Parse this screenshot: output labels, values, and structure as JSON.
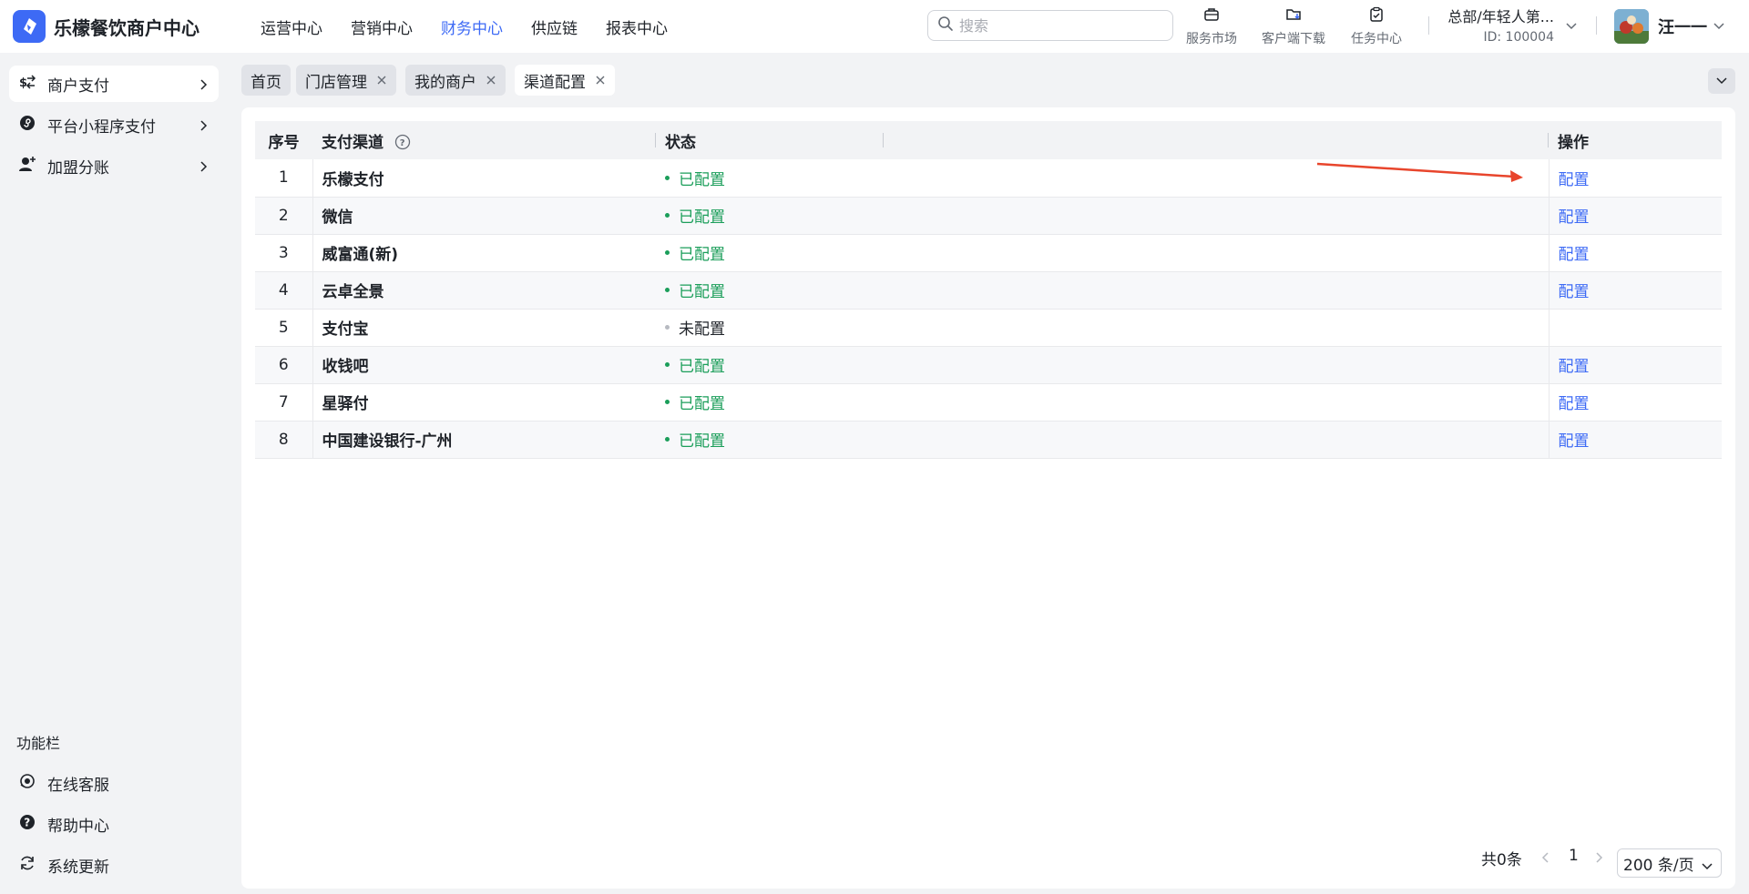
{
  "brand": {
    "name": "乐檬餐饮商户中心"
  },
  "topnav": [
    {
      "label": "运营中心",
      "active": false
    },
    {
      "label": "营销中心",
      "active": false
    },
    {
      "label": "财务中心",
      "active": true
    },
    {
      "label": "供应链",
      "active": false
    },
    {
      "label": "报表中心",
      "active": false
    }
  ],
  "search": {
    "placeholder": "搜索",
    "value": ""
  },
  "tools": [
    {
      "label": "服务市场",
      "icon": "briefcase-icon"
    },
    {
      "label": "客户端下载",
      "icon": "folder-download-icon"
    },
    {
      "label": "任务中心",
      "icon": "clipboard-check-icon"
    }
  ],
  "org": {
    "name": "总部/年轻人第...",
    "id": "ID: 100004"
  },
  "user": {
    "name": "汪一一"
  },
  "sidebar": {
    "items": [
      {
        "label": "商户支付",
        "icon": "dollar-exchange-icon",
        "active": true
      },
      {
        "label": "平台小程序支付",
        "icon": "mini-program-icon",
        "active": false
      },
      {
        "label": "加盟分账",
        "icon": "user-add-icon",
        "active": false
      }
    ],
    "section_title": "功能栏",
    "footer_items": [
      {
        "label": "在线客服",
        "icon": "headset-icon"
      },
      {
        "label": "帮助中心",
        "icon": "help-icon"
      },
      {
        "label": "系统更新",
        "icon": "refresh-icon"
      }
    ]
  },
  "tabs": [
    {
      "label": "首页",
      "closable": false,
      "active": false
    },
    {
      "label": "门店管理",
      "closable": true,
      "active": false
    },
    {
      "label": "我的商户",
      "closable": true,
      "active": false
    },
    {
      "label": "渠道配置",
      "closable": true,
      "active": true
    }
  ],
  "table": {
    "columns": {
      "seq": "序号",
      "channel": "支付渠道",
      "status": "状态",
      "action": "操作"
    },
    "rows": [
      {
        "seq": "1",
        "channel": "乐檬支付",
        "status": "已配置",
        "configured": true,
        "action": "配置"
      },
      {
        "seq": "2",
        "channel": "微信",
        "status": "已配置",
        "configured": true,
        "action": "配置"
      },
      {
        "seq": "3",
        "channel": "威富通(新)",
        "status": "已配置",
        "configured": true,
        "action": "配置"
      },
      {
        "seq": "4",
        "channel": "云卓全景",
        "status": "已配置",
        "configured": true,
        "action": "配置"
      },
      {
        "seq": "5",
        "channel": "支付宝",
        "status": "未配置",
        "configured": false,
        "action": ""
      },
      {
        "seq": "6",
        "channel": "收钱吧",
        "status": "已配置",
        "configured": true,
        "action": "配置"
      },
      {
        "seq": "7",
        "channel": "星驿付",
        "status": "已配置",
        "configured": true,
        "action": "配置"
      },
      {
        "seq": "8",
        "channel": "中国建设银行-广州",
        "status": "已配置",
        "configured": true,
        "action": "配置"
      }
    ]
  },
  "pagination": {
    "total": "共0条",
    "current_page": "1",
    "page_size": "200 条/页"
  },
  "colors": {
    "accent": "#3d6af5",
    "success": "#1b9e5a",
    "annotation": "#e8452c"
  }
}
